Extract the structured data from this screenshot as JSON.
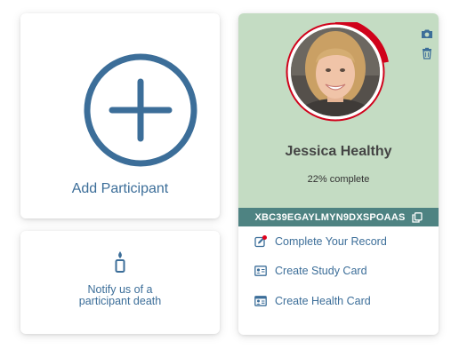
{
  "add_participant": {
    "label": "Add Participant",
    "icon": "plus-circle-icon"
  },
  "notify": {
    "label_line1": "Notify us of a",
    "label_line2": "participant death",
    "icon": "candle-icon"
  },
  "participant": {
    "name": "Jessica Healthy",
    "progress_text": "22% complete",
    "progress_fraction": 0.22,
    "code": "XBC39EGAYLMYN9DXSPOAAS",
    "icons": {
      "camera": "camera-icon",
      "delete": "trash-icon",
      "copy": "copy-icon"
    },
    "actions": [
      {
        "label": "Complete Your Record",
        "icon": "edit-notification-icon"
      },
      {
        "label": "Create Study Card",
        "icon": "id-card-icon"
      },
      {
        "label": "Create Health Card",
        "icon": "health-card-icon"
      }
    ]
  },
  "colors": {
    "accent_blue": "#3c6e99",
    "card_green": "#c4dcc3",
    "code_bar_teal": "#4e8382",
    "progress_red": "#d0021b",
    "notification_red": "#e0001b"
  }
}
